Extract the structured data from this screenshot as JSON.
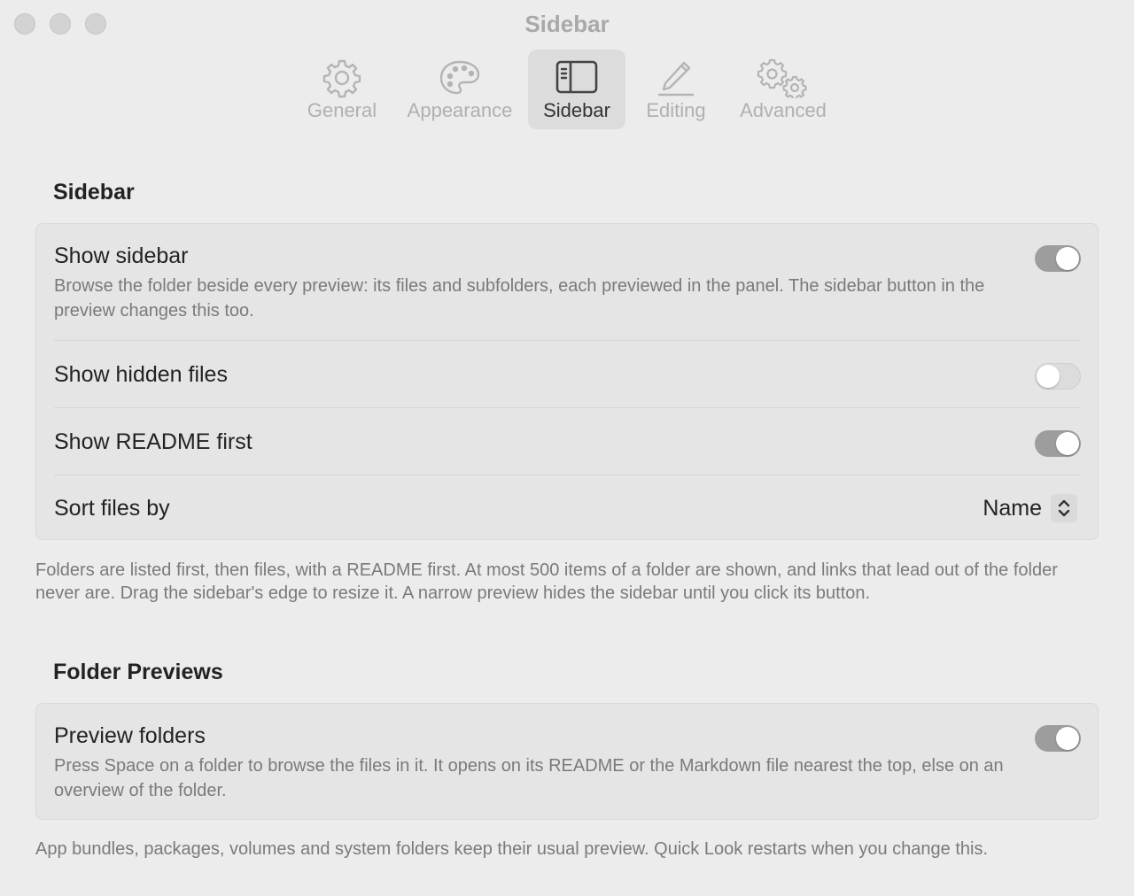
{
  "window": {
    "title": "Sidebar"
  },
  "toolbar": {
    "tabs": [
      {
        "label": "General",
        "icon": "gear-icon",
        "active": false
      },
      {
        "label": "Appearance",
        "icon": "palette-icon",
        "active": false
      },
      {
        "label": "Sidebar",
        "icon": "sidebar-icon",
        "active": true
      },
      {
        "label": "Editing",
        "icon": "pencil-icon",
        "active": false
      },
      {
        "label": "Advanced",
        "icon": "gears-icon",
        "active": false
      }
    ]
  },
  "sidebar_section": {
    "title": "Sidebar",
    "rows": {
      "show_sidebar": {
        "label": "Show sidebar",
        "description": "Browse the folder beside every preview: its files and subfolders, each previewed in the panel. The sidebar button in the preview changes this too.",
        "enabled": true
      },
      "show_hidden_files": {
        "label": "Show hidden files",
        "enabled": false
      },
      "show_readme_first": {
        "label": "Show README first",
        "enabled": true
      },
      "sort_files_by": {
        "label": "Sort files by",
        "value": "Name"
      }
    },
    "footnote": "Folders are listed first, then files, with a README first. At most 500 items of a folder are shown, and links that lead out of the folder never are. Drag the sidebar's edge to resize it. A narrow preview hides the sidebar until you click its button."
  },
  "folder_previews_section": {
    "title": "Folder Previews",
    "rows": {
      "preview_folders": {
        "label": "Preview folders",
        "description": "Press Space on a folder to browse the files in it. It opens on its README or the Markdown file nearest the top, else on an overview of the folder.",
        "enabled": true
      }
    },
    "footnote": "App bundles, packages, volumes and system folders keep their usual preview. Quick Look restarts when you change this."
  },
  "colors": {
    "background": "#ececec",
    "group_background": "#e5e5e5",
    "toggle_on": "#9d9d9d",
    "toggle_off": "#dcdcdc",
    "active_tab": "#dcdcdc",
    "secondary_text": "#7a7a7a"
  }
}
